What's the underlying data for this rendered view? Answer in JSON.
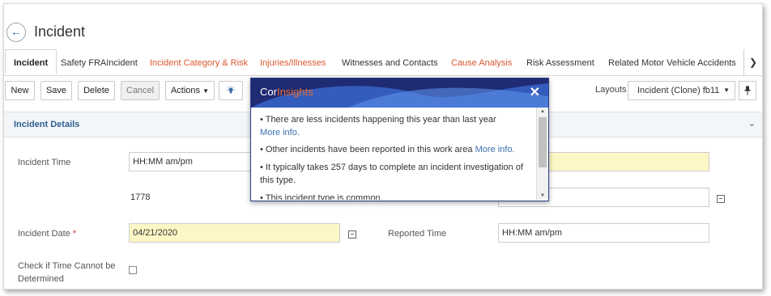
{
  "header": {
    "back_icon": "arrow-left-icon",
    "title": "Incident"
  },
  "tabs": [
    {
      "label": "Incident",
      "active": true
    },
    {
      "label": "Safety FRAIncident"
    },
    {
      "label": "Incident Category & Risk",
      "color": "#d9572b"
    },
    {
      "label": "Injuries/Illnesses",
      "color": "#d9572b"
    },
    {
      "label": "Witnesses and Contacts"
    },
    {
      "label": "Cause Analysis",
      "color": "#d9572b"
    },
    {
      "label": "Risk Assessment"
    },
    {
      "label": "Related Motor Vehicle Accidents"
    }
  ],
  "tabs_next_icon": "chevron-right-icon",
  "toolbar": {
    "new_label": "New",
    "save_label": "Save",
    "delete_label": "Delete",
    "cancel_label": "Cancel",
    "actions_label": "Actions",
    "insights_icon": "lightbulb-icon",
    "layouts_label": "Layouts",
    "layout_value": "Incident (Clone) fb11",
    "pin_icon": "pin-icon"
  },
  "section": {
    "title": "Incident Details",
    "collapse_icon": "chevron-down-icon"
  },
  "form": {
    "incident_time_label": "Incident Time",
    "incident_time_placeholder": "HH:MM am/pm",
    "incident_number": "1778",
    "incident_date_label": "Incident Date",
    "required_mark": "*",
    "incident_date_value": "04/21/2020",
    "reported_time_label": "Reported Time",
    "reported_time_placeholder": "HH:MM am/pm",
    "cannot_determine_label": "Check if Time Cannot be Determined"
  },
  "insights_popup": {
    "brand_part1": "Cor",
    "brand_part2": "Insights",
    "close_icon": "close-icon",
    "items": [
      {
        "text": "There are less incidents happening this year than last year",
        "link": "More info."
      },
      {
        "text": "Other incidents have been reported in this work area",
        "link": "More info."
      },
      {
        "text": "It typically takes 257 days to complete an incident investigation of this type."
      },
      {
        "text": "This incident type is common."
      }
    ]
  },
  "colors": {
    "accent_orange": "#d9572b",
    "popup_header": "#1f2b73",
    "link": "#3a6fb0",
    "required_field": "#fdf7c6"
  }
}
